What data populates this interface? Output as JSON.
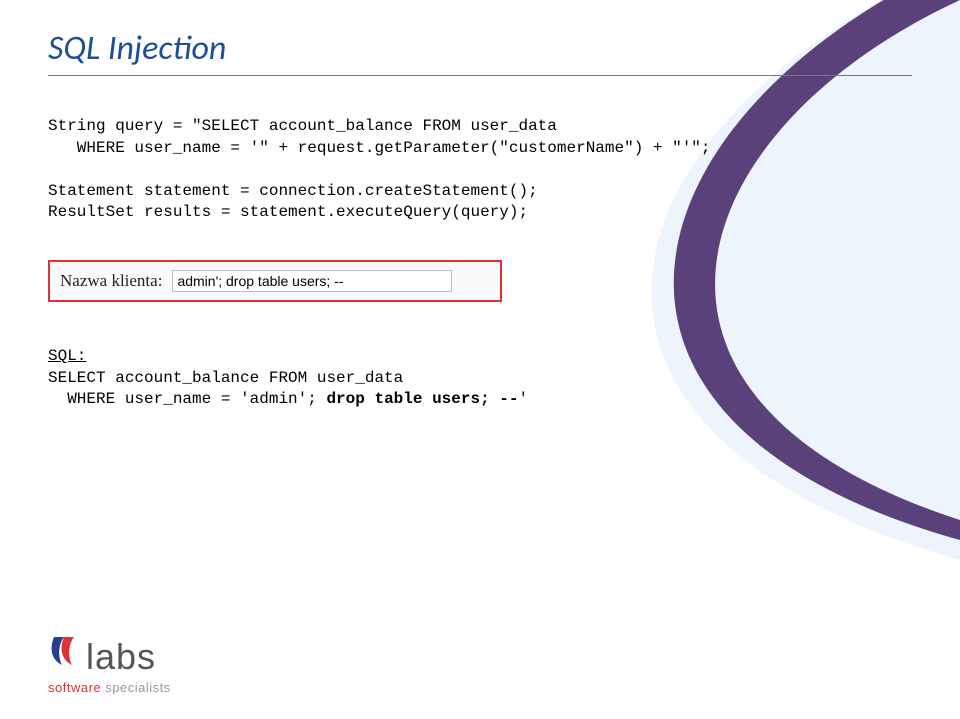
{
  "slide": {
    "title": "SQL Injection",
    "code_line1": "String query = \"SELECT account_balance FROM user_data",
    "code_line2": "   WHERE user_name = '\" + request.getParameter(\"customerName\") + \"'\";",
    "code_line3": "Statement statement = connection.createStatement();",
    "code_line4": "ResultSet results = statement.executeQuery(query);",
    "input_label": "Nazwa klienta:",
    "input_value": "admin'; drop table users; --",
    "sql_label": "SQL:",
    "sql_line1": "SELECT account_balance FROM user_data",
    "sql_line2_plain": "  WHERE user_name = 'admin'; ",
    "sql_line2_bold": "drop table users; --",
    "sql_line2_tail": "'"
  },
  "logo": {
    "name": "labs",
    "tagline_a": "software",
    "tagline_b": "specialists"
  }
}
